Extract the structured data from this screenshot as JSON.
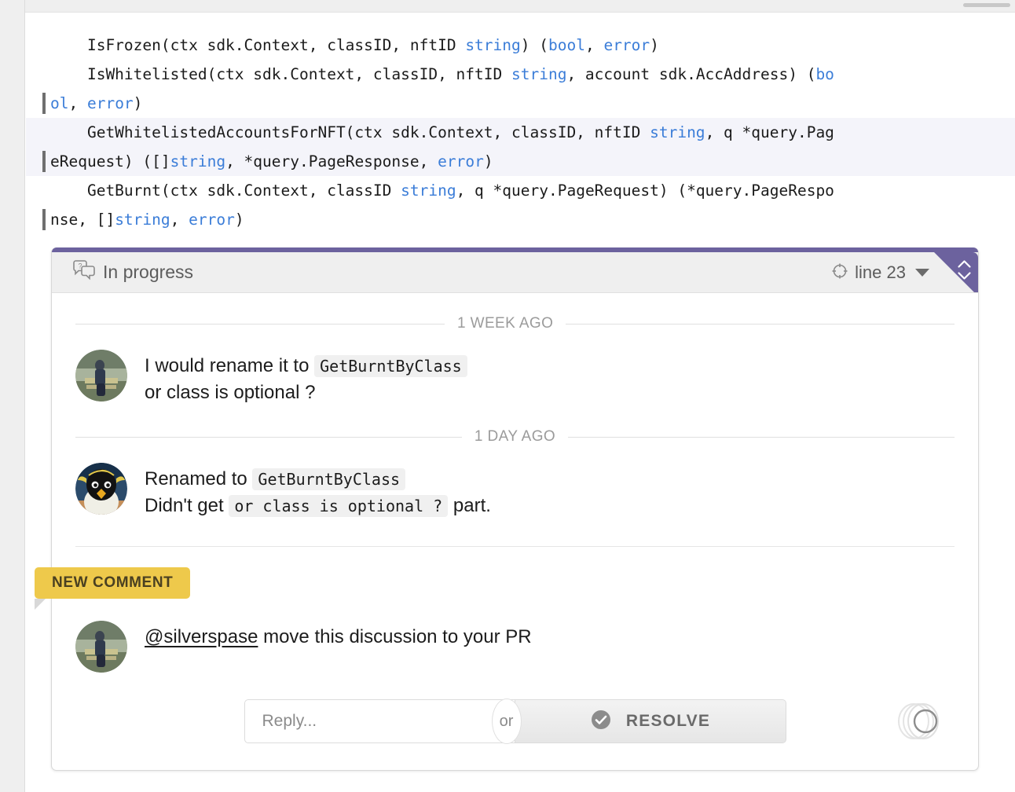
{
  "window": {
    "scrollbar": "horizontal-scrollbar"
  },
  "code": {
    "lines": [
      {
        "id": "line-is-frozen",
        "highlight": false,
        "segments": [
          {
            "t": "    IsFrozen(ctx sdk.Context, classID, nftID ",
            "k": false
          },
          {
            "t": "string",
            "k": true
          },
          {
            "t": ") (",
            "k": false
          },
          {
            "t": "bool",
            "k": true
          },
          {
            "t": ", ",
            "k": false
          },
          {
            "t": "error",
            "k": true
          },
          {
            "t": ")",
            "k": false
          }
        ]
      },
      {
        "id": "line-is-whitelisted",
        "highlight": false,
        "segments": [
          {
            "t": "    IsWhitelisted(ctx sdk.Context, classID, nftID ",
            "k": false
          },
          {
            "t": "string",
            "k": true
          },
          {
            "t": ", account sdk.AccAddress) (",
            "k": false
          },
          {
            "t": "bo",
            "k": true
          }
        ]
      },
      {
        "id": "line-is-whitelisted-wrap",
        "highlight": false,
        "wrapped": true,
        "segments": [
          {
            "t": "ol",
            "k": true
          },
          {
            "t": ", ",
            "k": false
          },
          {
            "t": "error",
            "k": true
          },
          {
            "t": ")",
            "k": false
          }
        ]
      },
      {
        "id": "line-get-whitelisted-accounts",
        "highlight": true,
        "segments": [
          {
            "t": "    GetWhitelistedAccountsForNFT(ctx sdk.Context, classID, nftID ",
            "k": false
          },
          {
            "t": "string",
            "k": true
          },
          {
            "t": ", q *query.Pag",
            "k": false
          }
        ]
      },
      {
        "id": "line-get-whitelisted-accounts-wrap",
        "highlight": true,
        "wrapped": true,
        "segments": [
          {
            "t": "eRequest) ([]",
            "k": false
          },
          {
            "t": "string",
            "k": true
          },
          {
            "t": ", *query.PageResponse, ",
            "k": false
          },
          {
            "t": "error",
            "k": true
          },
          {
            "t": ")",
            "k": false
          }
        ]
      },
      {
        "id": "line-get-burnt",
        "highlight": false,
        "segments": [
          {
            "t": "    GetBurnt(ctx sdk.Context, classID ",
            "k": false
          },
          {
            "t": "string",
            "k": true
          },
          {
            "t": ", q *query.PageRequest) (*query.PageRespo",
            "k": false
          }
        ]
      },
      {
        "id": "line-get-burnt-wrap",
        "highlight": false,
        "wrapped": true,
        "segments": [
          {
            "t": "nse, []",
            "k": false
          },
          {
            "t": "string",
            "k": true
          },
          {
            "t": ", ",
            "k": false
          },
          {
            "t": "error",
            "k": true
          },
          {
            "t": ")",
            "k": false
          }
        ]
      }
    ]
  },
  "discussion": {
    "accent_color": "#6c629e",
    "status_label": "In progress",
    "status_icon": "question-speech-bubble-icon",
    "line_reference": "line 23",
    "line_icon": "crosshair-icon",
    "dropdown_icon": "chevron-down-icon",
    "corner_icon": "code-brackets-icon",
    "threads": [
      {
        "timestamp": "1 WEEK AGO",
        "avatar": "person-on-bench-avatar",
        "lines": [
          [
            {
              "t": "I would rename it to ",
              "code": false
            },
            {
              "t": "GetBurntByClass",
              "code": true
            }
          ],
          [
            {
              "t": "or class is optional ?",
              "code": false
            }
          ]
        ]
      },
      {
        "timestamp": "1 DAY AGO",
        "avatar": "penguin-avatar",
        "lines": [
          [
            {
              "t": "Renamed to ",
              "code": false
            },
            {
              "t": "GetBurntByClass",
              "code": true
            }
          ],
          [
            {
              "t": "Didn't get ",
              "code": false
            },
            {
              "t": "or class is optional ?",
              "code": true
            },
            {
              "t": " part.",
              "code": false
            }
          ]
        ]
      }
    ],
    "new_comment": {
      "badge_label": "NEW COMMENT",
      "badge_color": "#eec94b",
      "avatar": "person-on-bench-avatar",
      "mention": "@silverspase",
      "text": " move this discussion to your PR"
    },
    "footer": {
      "reply_placeholder": "Reply...",
      "reply_value": "",
      "or_label": "or",
      "resolve_label": "RESOLVE",
      "resolve_icon": "check-circle-icon",
      "stack_icon": "stacked-circles-icon"
    }
  }
}
